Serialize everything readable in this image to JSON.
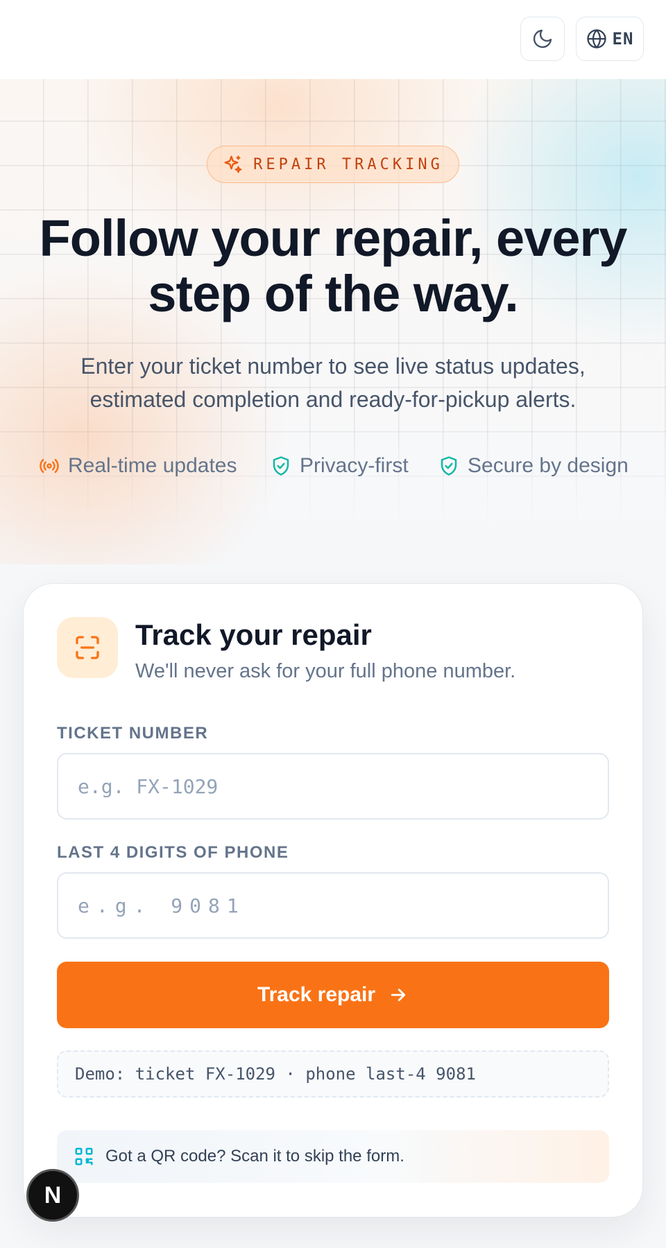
{
  "header": {
    "theme_icon": "moon-icon",
    "language_icon": "globe-icon",
    "language": "EN"
  },
  "hero": {
    "badge_icon": "sparkles-icon",
    "badge": "REPAIR TRACKING",
    "headline_line1": "Follow your repair, every",
    "headline_line2": "step of the way.",
    "subtext_line1": "Enter your ticket number to see live status updates,",
    "subtext_line2": "estimated completion and ready-for-pickup alerts.",
    "features": [
      {
        "icon": "broadcast-icon",
        "label": "Real-time updates",
        "color": "#f97316"
      },
      {
        "icon": "shield-check-icon",
        "label": "Privacy-first",
        "color": "#14b8a6"
      },
      {
        "icon": "shield-check-icon",
        "label": "Secure by design",
        "color": "#14b8a6"
      }
    ]
  },
  "card": {
    "icon": "scan-icon",
    "title": "Track your repair",
    "subtitle": "We'll never ask for your full phone number.",
    "ticket_label": "TICKET NUMBER",
    "ticket_placeholder": "e.g. FX-1029",
    "ticket_value": "",
    "phone_label": "LAST 4 DIGITS OF PHONE",
    "phone_placeholder": "e.g. 9081",
    "phone_value": "",
    "button_label": "Track repair",
    "button_icon": "arrow-right-icon",
    "demo_hint": "Demo: ticket FX-1029 · phone last-4 9081",
    "qr_icon": "qr-code-icon",
    "qr_hint": "Got a QR code? Scan it to skip the form."
  },
  "dev_badge": "N",
  "colors": {
    "accent": "#f97316",
    "teal": "#14b8a6",
    "heading": "#111827",
    "muted": "#64748b"
  }
}
